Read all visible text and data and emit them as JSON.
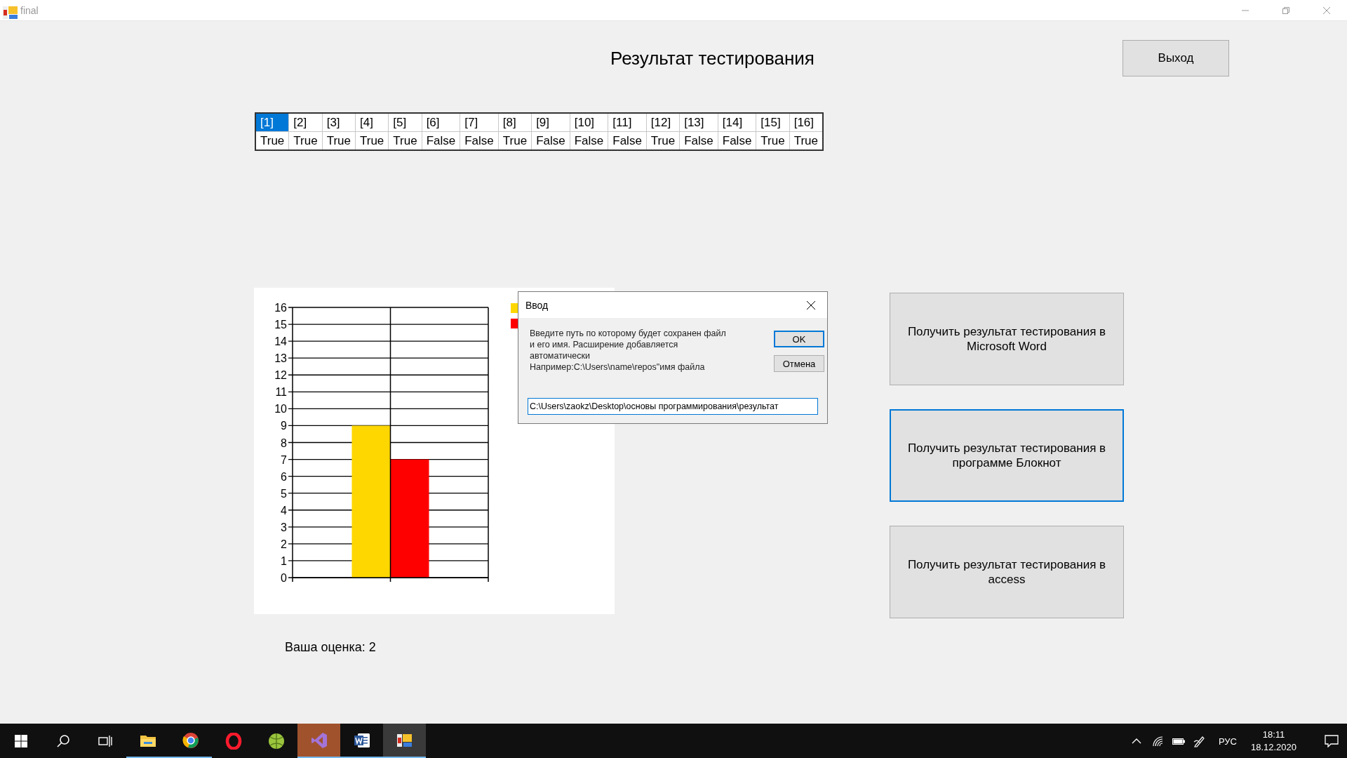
{
  "window": {
    "title": "final"
  },
  "heading": "Результат тестирования",
  "exit_button": "Выход",
  "answers": [
    {
      "label": "[1]",
      "value": "True",
      "selected": true
    },
    {
      "label": "[2]",
      "value": "True",
      "selected": false
    },
    {
      "label": "[3]",
      "value": "True",
      "selected": false
    },
    {
      "label": "[4]",
      "value": "True",
      "selected": false
    },
    {
      "label": "[5]",
      "value": "True",
      "selected": false
    },
    {
      "label": "[6]",
      "value": "False",
      "selected": false
    },
    {
      "label": "[7]",
      "value": "False",
      "selected": false
    },
    {
      "label": "[8]",
      "value": "True",
      "selected": false
    },
    {
      "label": "[9]",
      "value": "False",
      "selected": false
    },
    {
      "label": "[10]",
      "value": "False",
      "selected": false
    },
    {
      "label": "[11]",
      "value": "False",
      "selected": false
    },
    {
      "label": "[12]",
      "value": "True",
      "selected": false
    },
    {
      "label": "[13]",
      "value": "False",
      "selected": false
    },
    {
      "label": "[14]",
      "value": "False",
      "selected": false
    },
    {
      "label": "[15]",
      "value": "True",
      "selected": false
    },
    {
      "label": "[16]",
      "value": "True",
      "selected": false
    }
  ],
  "chart": {
    "chart_data": {
      "type": "bar",
      "grid": true,
      "ylim": [
        0,
        16
      ],
      "yticks": [
        0,
        1,
        2,
        3,
        4,
        5,
        6,
        7,
        8,
        9,
        10,
        11,
        12,
        13,
        14,
        15,
        16
      ],
      "series": [
        {
          "color": "#ffd700",
          "values": [
            9
          ]
        },
        {
          "color": "#ff0000",
          "values": [
            7
          ]
        }
      ]
    }
  },
  "grade": "Ваша оценка: 2",
  "actions": [
    {
      "label": "Получить результат тестирования в Microsoft Word",
      "selected": false
    },
    {
      "label": "Получить результат тестирования в программе Блокнот",
      "selected": true
    },
    {
      "label": "Получить результат тестирования в access",
      "selected": false
    }
  ],
  "dialog": {
    "title": "Ввод",
    "message": "Введите путь по которому будет сохранен файл\nи его имя. Расширение добавляется\nавтоматически\nНапример:C:\\Users\\name\\repos\"имя файла",
    "ok_button": "OK",
    "cancel_button": "Отмена",
    "value": "C:\\Users\\zaokz\\Desktop\\основы программирования\\результат"
  },
  "taskbar": {
    "apps": [
      {
        "kind": "start",
        "running": false,
        "active": false
      },
      {
        "kind": "search",
        "running": false,
        "active": false
      },
      {
        "kind": "taskview",
        "running": false,
        "active": false
      },
      {
        "kind": "folder",
        "running": true,
        "active": false
      },
      {
        "kind": "globe",
        "running": true,
        "active": false
      },
      {
        "kind": "ring",
        "running": false,
        "active": false
      },
      {
        "kind": "ball",
        "running": false,
        "active": false
      },
      {
        "kind": "studio",
        "running": true,
        "active": true
      },
      {
        "kind": "word",
        "running": true,
        "active": false
      },
      {
        "kind": "form",
        "running": true,
        "active": true
      }
    ],
    "language": "РУС",
    "time": "18:11",
    "date": "18.12.2020"
  }
}
